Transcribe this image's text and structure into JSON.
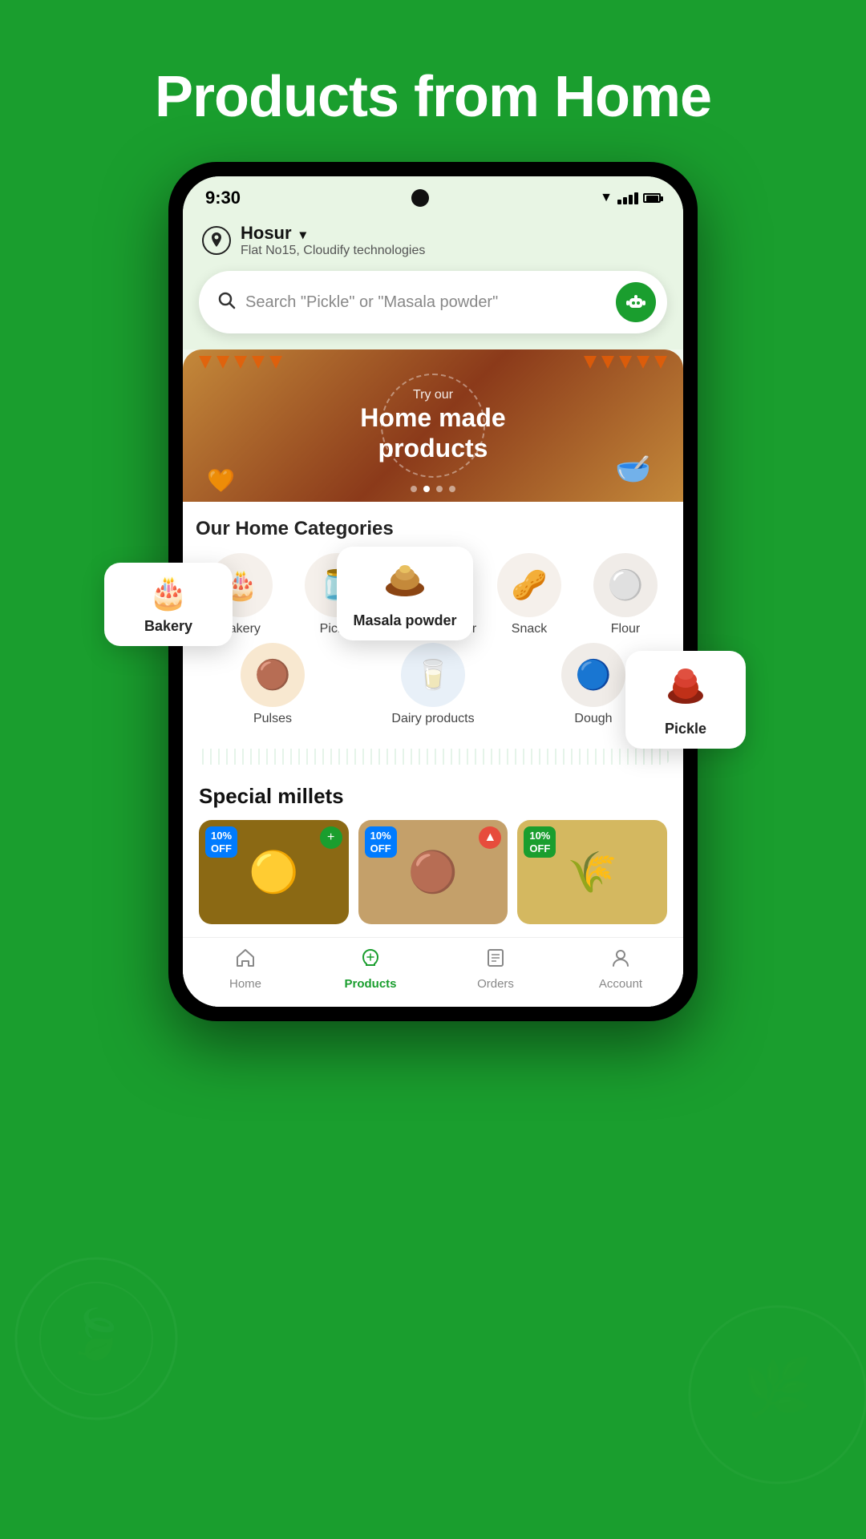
{
  "page": {
    "title": "Products from Home",
    "bg_color": "#1a9e2e"
  },
  "phone": {
    "status_bar": {
      "time": "9:30",
      "wifi": "▼",
      "signal": "▲",
      "battery": "🔋"
    },
    "location": {
      "city": "Hosur",
      "address": "Flat No15, Cloudify technologies"
    },
    "search": {
      "placeholder": "Search \"Pickle\" or \"Masala powder\""
    },
    "banner": {
      "try_text": "Try our",
      "main_text": "Home made\nproducts"
    },
    "categories": {
      "section_title": "Our H",
      "items": [
        {
          "label": "Bakery",
          "emoji": "🎂"
        },
        {
          "label": "Pickle",
          "emoji": "🫙"
        },
        {
          "label": "Masala powder",
          "emoji": "🫙"
        },
        {
          "label": "Snack",
          "emoji": "🥜"
        },
        {
          "label": "Flour",
          "emoji": "🫙"
        },
        {
          "label": "Pulses",
          "emoji": "🫘"
        },
        {
          "label": "Dairy products",
          "emoji": "🧴"
        },
        {
          "label": "Dough",
          "emoji": "⚪"
        }
      ]
    },
    "millets": {
      "section_title": "Special millets",
      "items": [
        {
          "badge_line1": "10%",
          "badge_line2": "OFF",
          "emoji": "🟡",
          "bg": "#c8a86b"
        },
        {
          "badge_line1": "10%",
          "badge_line2": "OFF",
          "emoji": "🟤",
          "bg": "#d4b896"
        },
        {
          "badge_line1": "10%",
          "badge_line2": "OFF",
          "emoji": "🟡",
          "bg": "#e8c870"
        }
      ]
    },
    "bottom_nav": {
      "items": [
        {
          "label": "Home",
          "icon": "⌂",
          "active": false
        },
        {
          "label": "Products",
          "icon": "♥",
          "active": true
        },
        {
          "label": "Orders",
          "icon": "📋",
          "active": false
        },
        {
          "label": "Account",
          "icon": "👤",
          "active": false
        }
      ]
    }
  },
  "float_cards": {
    "bakery": {
      "label": "Bakery",
      "emoji": "🎂"
    },
    "masala": {
      "label": "Masala powder",
      "emoji": "🫙"
    },
    "pickle": {
      "label": "Pickle",
      "emoji": "🫙"
    }
  }
}
